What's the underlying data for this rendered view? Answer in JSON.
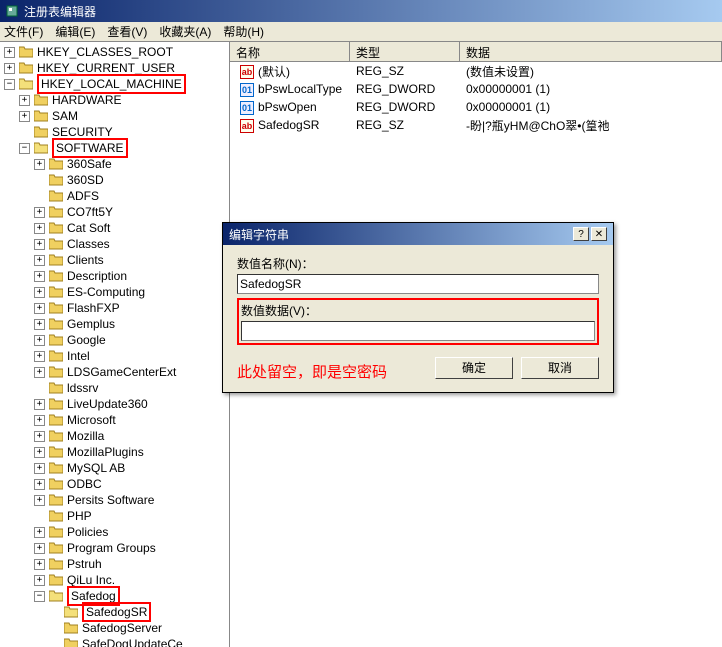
{
  "window": {
    "title": "注册表编辑器"
  },
  "menu": {
    "file": "文件(F)",
    "edit": "编辑(E)",
    "view": "查看(V)",
    "fav": "收藏夹(A)",
    "help": "帮助(H)"
  },
  "tree": {
    "hkcr": "HKEY_CLASSES_ROOT",
    "hkcu": "HKEY_CURRENT_USER",
    "hklm": "HKEY_LOCAL_MACHINE",
    "hardware": "HARDWARE",
    "sam": "SAM",
    "security": "SECURITY",
    "software": "SOFTWARE",
    "items": [
      "360Safe",
      "360SD",
      "ADFS",
      "CO7ft5Y",
      "Cat Soft",
      "Classes",
      "Clients",
      "Description",
      "ES-Computing",
      "FlashFXP",
      "Gemplus",
      "Google",
      "Intel",
      "LDSGameCenterExt",
      "ldssrv",
      "LiveUpdate360",
      "Microsoft",
      "Mozilla",
      "MozillaPlugins",
      "MySQL AB",
      "ODBC",
      "Persits Software",
      "PHP",
      "Policies",
      "Program Groups",
      "Pstruh",
      "QiLu Inc."
    ],
    "safedog": "Safedog",
    "safedogsr": "SafedogSR",
    "safedogserver": "SafedogServer",
    "safedogupdate": "SafeDogUpdateCe"
  },
  "list": {
    "cols": {
      "name": "名称",
      "type": "类型",
      "data": "数据"
    },
    "rows": [
      {
        "icon": "str",
        "name": "(默认)",
        "type": "REG_SZ",
        "data": "(数值未设置)"
      },
      {
        "icon": "bin",
        "name": "bPswLocalType",
        "type": "REG_DWORD",
        "data": "0x00000001 (1)"
      },
      {
        "icon": "bin",
        "name": "bPswOpen",
        "type": "REG_DWORD",
        "data": "0x00000001 (1)"
      },
      {
        "icon": "str",
        "name": "SafedogSR",
        "type": "REG_SZ",
        "data": "-盼|?瓶yHM@ChO翠•(篁祂"
      }
    ]
  },
  "dialog": {
    "title": "编辑字符串",
    "name_label": "数值名称(N)：",
    "name_value": "SafedogSR",
    "data_label": "数值数据(V)：",
    "data_value": "",
    "annotation": "此处留空，即是空密码",
    "ok": "确定",
    "cancel": "取消"
  }
}
